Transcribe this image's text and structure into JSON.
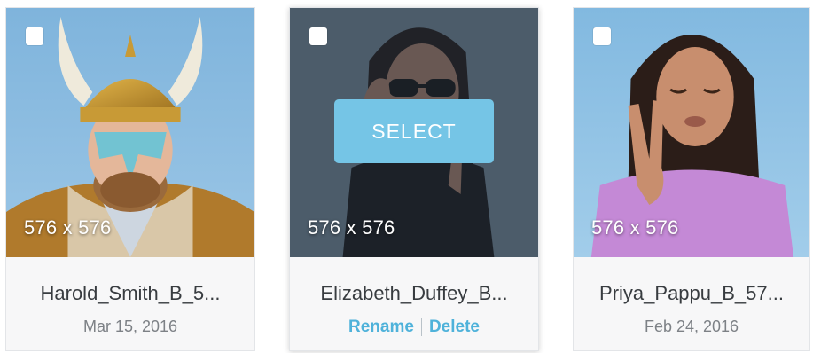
{
  "cards": [
    {
      "name": "Harold_Smith_B_5...",
      "date": "Mar 15, 2016",
      "dimensions": "576 x 576",
      "selected": false
    },
    {
      "name": "Elizabeth_Duffey_B...",
      "dimensions": "576 x 576",
      "select_label": "SELECT",
      "rename_label": "Rename",
      "delete_label": "Delete",
      "selected": false
    },
    {
      "name": "Priya_Pappu_B_57...",
      "date": "Feb 24, 2016",
      "dimensions": "576 x 576",
      "selected": false
    }
  ],
  "colors": {
    "accent": "#4fb2da",
    "select_button": "#75c5e6",
    "card_bg": "#f7f7f8"
  }
}
